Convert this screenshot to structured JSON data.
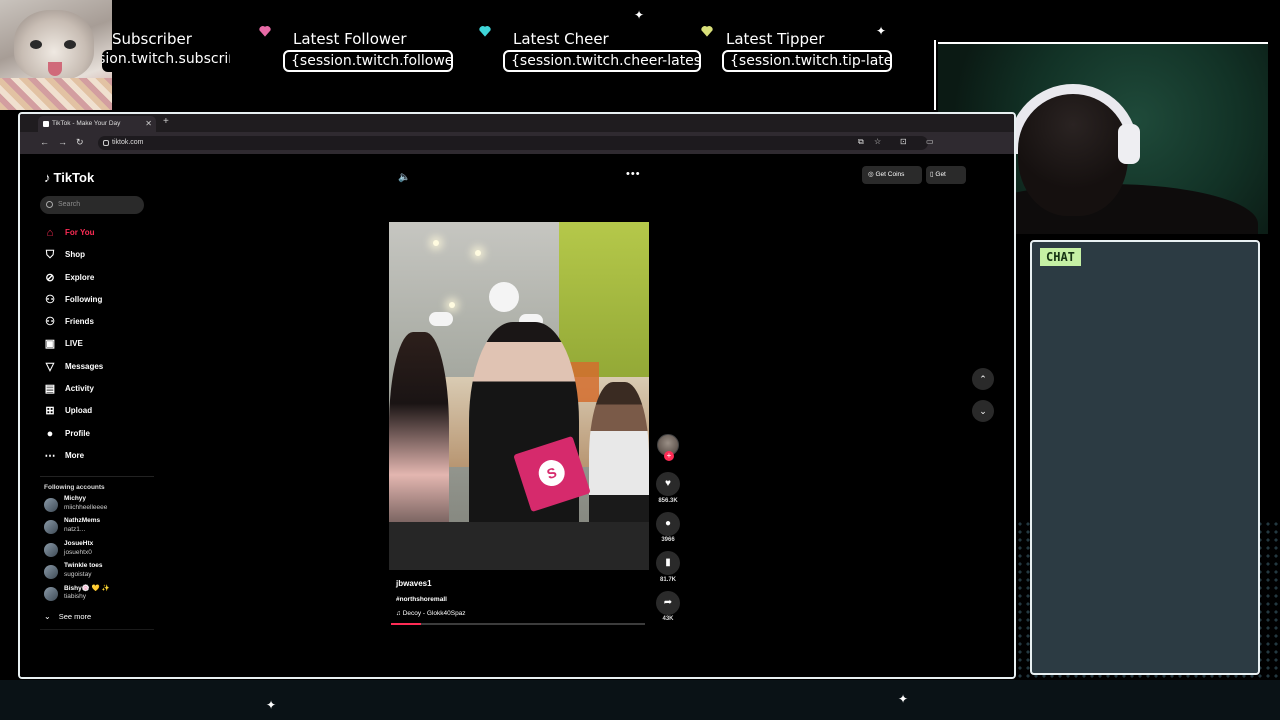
{
  "overlay": {
    "alerts": [
      {
        "title": "Subscriber",
        "value": "{session.twitch.subscriber-latest.name}"
      },
      {
        "title": "Latest Follower",
        "value": "{session.twitch.follower-latest.name}"
      },
      {
        "title": "Latest Cheer",
        "value": "{session.twitch.cheer-latest.name}"
      },
      {
        "title": "Latest Tipper",
        "value": "{session.twitch.tip-latest.name}"
      }
    ],
    "chat_label": "CHAT",
    "colors": {
      "heart_pink": "#e86aa6",
      "heart_cyan": "#3fd6d9",
      "heart_yellow": "#d9e07a",
      "chat_bg": "#2c3b43",
      "chat_label_bg": "#c5f0a4"
    }
  },
  "browser": {
    "tab_title": "TikTok - Make Your Day",
    "url": "tiktok.com"
  },
  "tiktok": {
    "logo": "TikTok",
    "search_placeholder": "Search",
    "nav": [
      {
        "label": "For You",
        "icon": "home-icon",
        "glyph": "⌂",
        "active": true
      },
      {
        "label": "Shop",
        "icon": "shop-icon",
        "glyph": "⛉"
      },
      {
        "label": "Explore",
        "icon": "compass-icon",
        "glyph": "⊘"
      },
      {
        "label": "Following",
        "icon": "following-icon",
        "glyph": "⚇"
      },
      {
        "label": "Friends",
        "icon": "friends-icon",
        "glyph": "⚇"
      },
      {
        "label": "LIVE",
        "icon": "live-icon",
        "glyph": "▣"
      },
      {
        "label": "Messages",
        "icon": "messages-icon",
        "glyph": "▽"
      },
      {
        "label": "Activity",
        "icon": "activity-icon",
        "glyph": "▤"
      },
      {
        "label": "Upload",
        "icon": "upload-icon",
        "glyph": "⊞"
      },
      {
        "label": "Profile",
        "icon": "profile-icon",
        "glyph": "●"
      },
      {
        "label": "More",
        "icon": "more-icon",
        "glyph": "⋯"
      }
    ],
    "following_title": "Following accounts",
    "accounts": [
      {
        "name": "Michyy",
        "handle": "miichheelleeee"
      },
      {
        "name": "NathzMems",
        "handle": "natz1..."
      },
      {
        "name": "JosueHtx",
        "handle": "josuehtx0"
      },
      {
        "name": "Twinkle toes",
        "handle": "sugoistay"
      },
      {
        "name": "Bishy🍥 💛 ✨",
        "handle": "tiabishy"
      }
    ],
    "see_more": "See more",
    "get_coins": "Get Coins",
    "get_app": "Get",
    "video": {
      "username": "jbwaves1",
      "hashtag": "#northshoremall",
      "music": "Decoy - Glokk40Spaz",
      "progress": 0.12
    },
    "actions": {
      "likes": "856.3K",
      "comments": "3966",
      "saves": "81.7K",
      "shares": "43K"
    }
  }
}
